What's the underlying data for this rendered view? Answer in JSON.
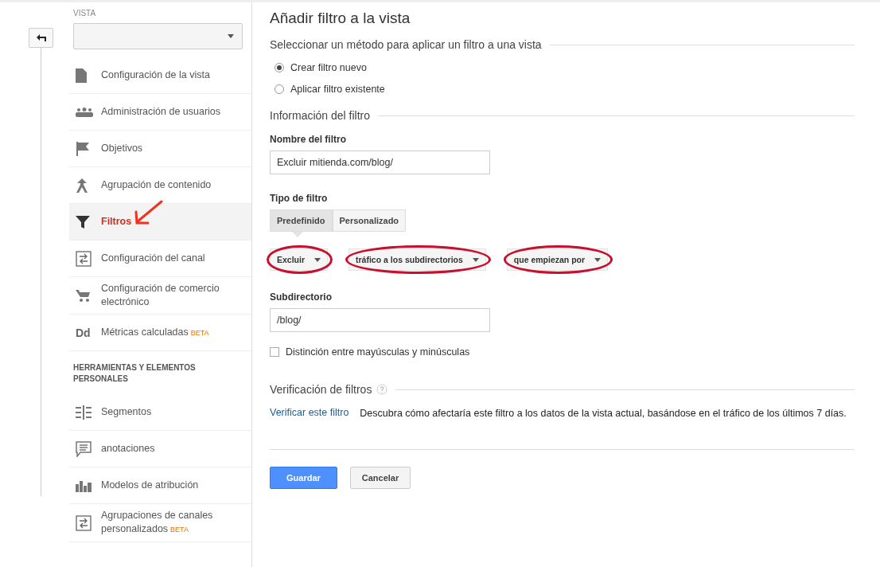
{
  "sidebar": {
    "section_label": "VISTA",
    "items": [
      {
        "label": "Configuración de la vista",
        "selected": false
      },
      {
        "label": "Administración de usuarios",
        "selected": false
      },
      {
        "label": "Objetivos",
        "selected": false
      },
      {
        "label": "Agrupación de contenido",
        "selected": false
      },
      {
        "label": "Filtros",
        "selected": true,
        "annotated": true
      },
      {
        "label": "Configuración del canal",
        "selected": false
      },
      {
        "label": "Configuración de comercio electrónico",
        "selected": false
      },
      {
        "label": "Métricas calculadas",
        "selected": false,
        "icon_text": "Dd",
        "badge": "BETA"
      }
    ],
    "tools_heading": "HERRAMIENTAS Y ELEMENTOS PERSONALES",
    "tools": [
      {
        "label": "Segmentos",
        "selected": false
      },
      {
        "label": "anotaciones",
        "selected": false
      },
      {
        "label": "Modelos de atribución",
        "selected": false
      },
      {
        "label": "Agrupaciones de canales personalizados",
        "selected": false,
        "badge": "BETA"
      }
    ]
  },
  "main": {
    "title": "Añadir filtro a la vista",
    "method_heading": "Seleccionar un método para aplicar un filtro a una vista",
    "methods": [
      {
        "label": "Crear filtro nuevo",
        "selected": true
      },
      {
        "label": "Aplicar filtro existente",
        "selected": false
      }
    ],
    "info_heading": "Información del filtro",
    "name_label": "Nombre del filtro",
    "name_value": "Excluir mitienda.com/blog/",
    "type_label": "Tipo de filtro",
    "type_tabs": [
      {
        "label": "Predefinido",
        "selected": true
      },
      {
        "label": "Personalizado",
        "selected": false
      }
    ],
    "dropdowns": [
      {
        "value": "Excluir",
        "highlighted": true
      },
      {
        "value": "tráfico a los subdirectorios",
        "highlighted": true
      },
      {
        "value": "que empiezan por",
        "highlighted": true
      }
    ],
    "subdir_label": "Subdirectorio",
    "subdir_value": "/blog/",
    "case_checkbox": {
      "label": "Distinción entre mayúsculas y minúsculas",
      "checked": false
    },
    "verify_heading": "Verificación de filtros",
    "verify_link": "Verificar este filtro",
    "verify_text": "Descubra cómo afectaría este filtro a los datos de la vista actual, basándose en el tráfico de los últimos 7 días.",
    "buttons": [
      {
        "label": "Guardar",
        "kind": "primary"
      },
      {
        "label": "Cancelar",
        "kind": "default"
      }
    ]
  }
}
